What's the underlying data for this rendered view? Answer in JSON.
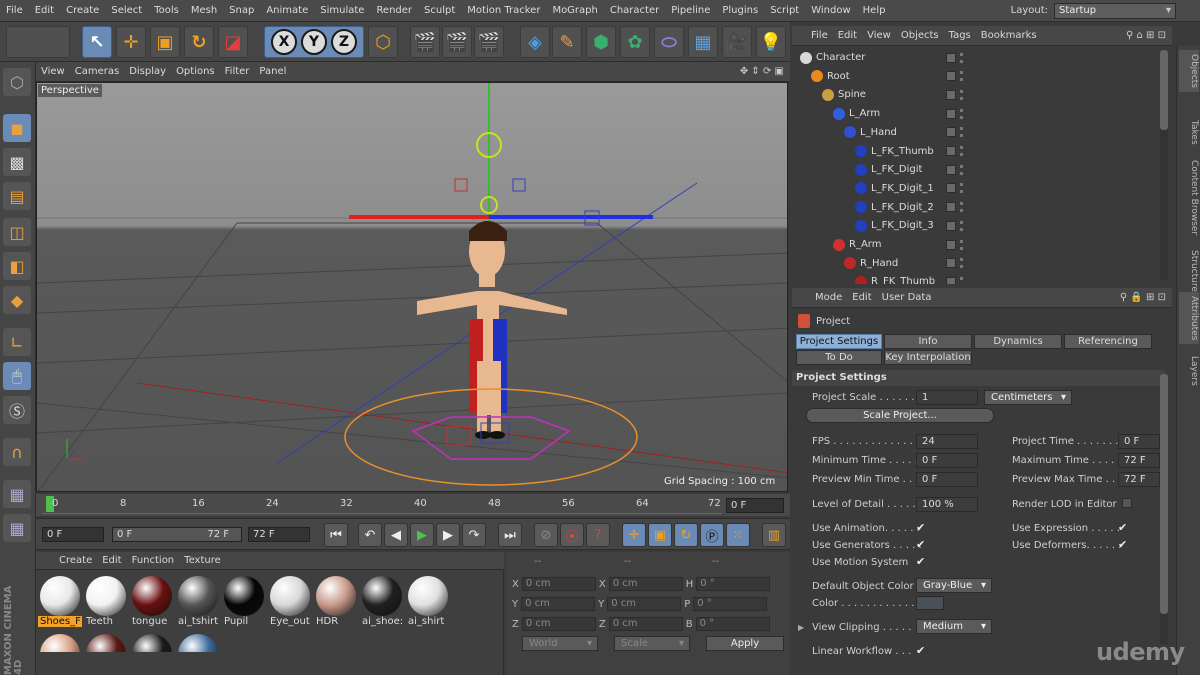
{
  "menubar": {
    "items": [
      "File",
      "Edit",
      "Create",
      "Select",
      "Tools",
      "Mesh",
      "Snap",
      "Animate",
      "Simulate",
      "Render",
      "Sculpt",
      "Motion Tracker",
      "MoGraph",
      "Character",
      "Pipeline",
      "Plugins",
      "Script",
      "Window",
      "Help"
    ],
    "layout_label": "Layout:",
    "layout_value": "Startup"
  },
  "toolbar": {
    "axis_x": "X",
    "axis_y": "Y",
    "axis_z": "Z"
  },
  "viewport": {
    "menu": [
      "View",
      "Cameras",
      "Display",
      "Options",
      "Filter",
      "Panel"
    ],
    "label": "Perspective",
    "grid_spacing": "Grid Spacing : 100 cm"
  },
  "timeline": {
    "ticks": [
      "0",
      "8",
      "16",
      "24",
      "32",
      "40",
      "48",
      "56",
      "64",
      "72"
    ],
    "current_frame": "0 F"
  },
  "transport": {
    "start": "0 F",
    "range_start": "0 F",
    "range_end": "72 F",
    "end": "72 F"
  },
  "materials": {
    "menu": [
      "Create",
      "Edit",
      "Function",
      "Texture"
    ],
    "row1": [
      {
        "name": "Shoes_F",
        "color": "#e8e8e8",
        "selected": true
      },
      {
        "name": "Teeth",
        "color": "#f2f2f2"
      },
      {
        "name": "tongue",
        "color": "#6a1010"
      },
      {
        "name": "ai_tshirt",
        "color": "#555555"
      },
      {
        "name": "Pupil",
        "color": "#050505"
      },
      {
        "name": "Eye_out",
        "color": "#d8d8d8"
      },
      {
        "name": "HDR",
        "color": "#c89a8a"
      },
      {
        "name": "ai_shoe:",
        "color": "#202020"
      },
      {
        "name": "ai_shirt",
        "color": "#e0e0e0"
      }
    ],
    "row2_colors": [
      "#d8a088",
      "#5a1a14",
      "#1a1a1a",
      "#3a6a9a"
    ],
    "brand": "MAXON CINEMA 4D"
  },
  "coords": {
    "header": [
      "--",
      "--",
      "--"
    ],
    "rows": [
      {
        "a": "X",
        "av": "0 cm",
        "b": "X",
        "bv": "0 cm",
        "c": "H",
        "cv": "0 °"
      },
      {
        "a": "Y",
        "av": "0 cm",
        "b": "Y",
        "bv": "0 cm",
        "c": "P",
        "cv": "0 °"
      },
      {
        "a": "Z",
        "av": "0 cm",
        "b": "Z",
        "bv": "0 cm",
        "c": "B",
        "cv": "0 °"
      }
    ],
    "world": "World",
    "scale": "Scale",
    "apply": "Apply"
  },
  "objects": {
    "menu": [
      "File",
      "Edit",
      "View",
      "Objects",
      "Tags",
      "Bookmarks"
    ],
    "rows": [
      {
        "name": "Character",
        "indent": 0,
        "icon": "#d9d9d9"
      },
      {
        "name": "Root",
        "indent": 1,
        "icon": "#e8891c"
      },
      {
        "name": "Spine",
        "indent": 2,
        "icon": "#c8a040"
      },
      {
        "name": "L_Arm",
        "indent": 3,
        "icon": "#3060e0"
      },
      {
        "name": "L_Hand",
        "indent": 4,
        "icon": "#3050d0"
      },
      {
        "name": "L_FK_Thumb",
        "indent": 5,
        "icon": "#2040c0"
      },
      {
        "name": "L_FK_Digit",
        "indent": 5,
        "icon": "#2040c0"
      },
      {
        "name": "L_FK_Digit_1",
        "indent": 5,
        "icon": "#2040c0"
      },
      {
        "name": "L_FK_Digit_2",
        "indent": 5,
        "icon": "#2040c0"
      },
      {
        "name": "L_FK_Digit_3",
        "indent": 5,
        "icon": "#2040c0"
      },
      {
        "name": "R_Arm",
        "indent": 3,
        "icon": "#d03030"
      },
      {
        "name": "R_Hand",
        "indent": 4,
        "icon": "#c02828"
      },
      {
        "name": "R_FK_Thumb",
        "indent": 5,
        "icon": "#b02020"
      }
    ]
  },
  "side_tabs": [
    "Objects",
    "Takes",
    "Content Browser",
    "Structure",
    "Attributes",
    "Layers"
  ],
  "attributes": {
    "menu": [
      "Mode",
      "Edit",
      "User Data"
    ],
    "object": "Project",
    "tabs": [
      "Project Settings",
      "Info",
      "Dynamics",
      "Referencing",
      "To Do",
      "Key Interpolation"
    ],
    "section": "Project Settings",
    "project_scale_label": "Project Scale . . . . . .",
    "project_scale_value": "1",
    "project_scale_unit": "Centimeters",
    "scale_project_btn": "Scale Project...",
    "fps_label": "FPS . . . . . . . . . . . . .",
    "fps_value": "24",
    "project_time_label": "Project Time . . . . . . .",
    "project_time_value": "0 F",
    "min_time_label": "Minimum Time . . . . .",
    "min_time_value": "0 F",
    "max_time_label": "Maximum Time . . . . .",
    "max_time_value": "72 F",
    "prev_min_label": "Preview Min Time . . .",
    "prev_min_value": "0 F",
    "prev_max_label": "Preview Max Time . .",
    "prev_max_value": "72 F",
    "lod_label": "Level of Detail . . . . .",
    "lod_value": "100 %",
    "render_lod_label": "Render LOD in Editor",
    "use_anim_label": "Use Animation. . . . . .",
    "use_expr_label": "Use Expression . . . . .",
    "use_gen_label": "Use Generators . . . . .",
    "use_deform_label": "Use Deformers. . . . . .",
    "use_motion_label": "Use Motion System",
    "default_color_label": "Default Object Color",
    "default_color_value": "Gray-Blue",
    "color_label": "Color . . . . . . . . . . . .",
    "view_clip_label": "View Clipping . . . . .",
    "view_clip_value": "Medium",
    "linear_label": "Linear Workflow . . .",
    "check": "✔"
  },
  "watermark": "udemy"
}
